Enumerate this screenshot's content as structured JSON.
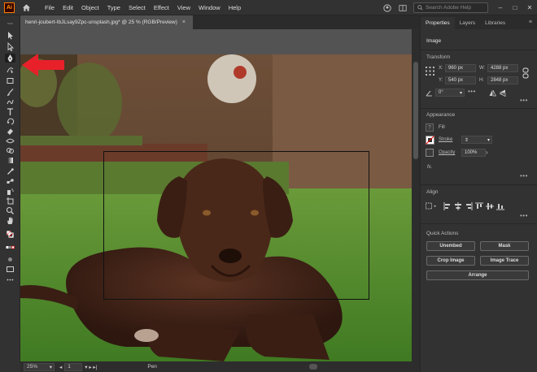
{
  "app": {
    "logo_text": "Ai",
    "menus": [
      "File",
      "Edit",
      "Object",
      "Type",
      "Select",
      "Effect",
      "View",
      "Window",
      "Help"
    ],
    "search_placeholder": "Search Adobe Help",
    "window_controls": [
      "–",
      "□",
      "✕"
    ]
  },
  "document": {
    "tab_title": "henri-joubert-IbJLsay9Zpc-unsplash.jpg* @ 25 % (RGB/Preview)",
    "close_glyph": "×"
  },
  "status": {
    "zoom": "25%",
    "page": "1",
    "tool": "Pen"
  },
  "panel": {
    "tabs": [
      "Properties",
      "Layers",
      "Libraries"
    ],
    "active_tab": "Properties",
    "selection_type": "Image",
    "transform": {
      "title": "Transform",
      "x_label": "X:",
      "x_value": "960 px",
      "y_label": "Y:",
      "y_value": "540 px",
      "w_label": "W:",
      "w_value": "4288 px",
      "h_label": "H:",
      "h_value": "2848 px",
      "angle_value": "0°"
    },
    "appearance": {
      "title": "Appearance",
      "fill_label": "Fill",
      "stroke_label": "Stroke",
      "opacity_label": "Opacity",
      "opacity_value": "100%",
      "fx_label": "fx."
    },
    "align": {
      "title": "Align"
    },
    "quick_actions": {
      "title": "Quick Actions",
      "buttons": [
        "Unembed",
        "Mask",
        "Crop Image",
        "Image Trace",
        "Arrange"
      ]
    }
  },
  "colors": {
    "ui_bg": "#323232",
    "canvas_bg": "#535353",
    "arrow": "#e8202a",
    "grass": "#4e8a2a",
    "dog": "#3b2016"
  }
}
